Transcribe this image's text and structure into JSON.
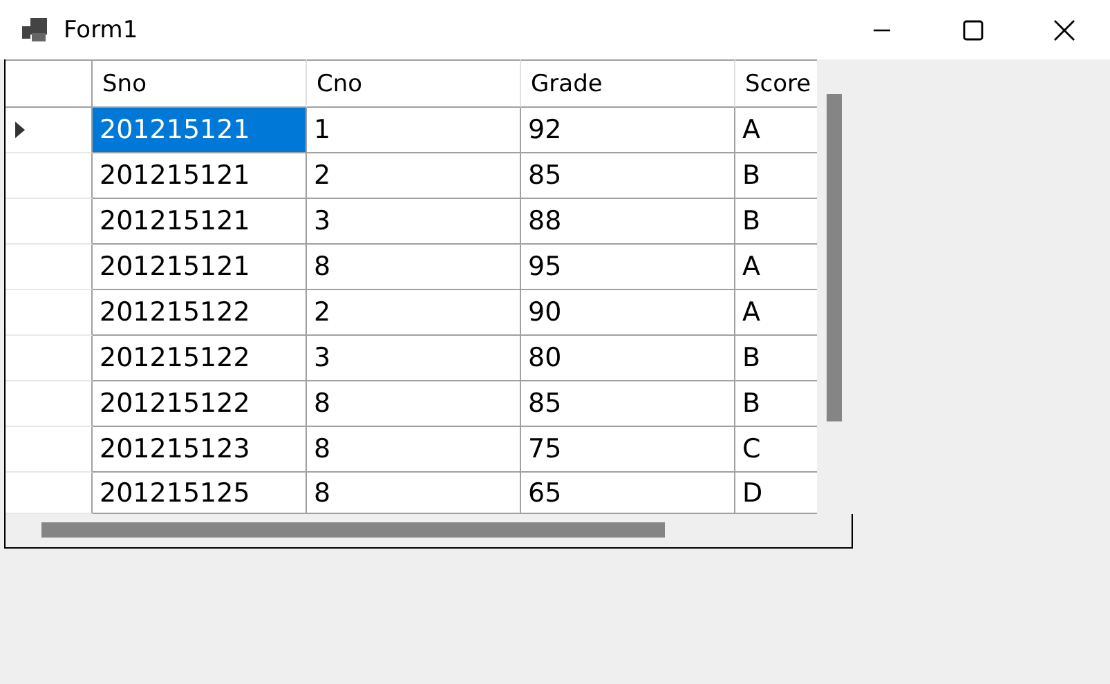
{
  "window": {
    "title": "Form1"
  },
  "table": {
    "columns": [
      "Sno",
      "Cno",
      "Grade",
      "Score"
    ],
    "rows": [
      {
        "current": true,
        "cells": [
          {
            "text": "201215121",
            "selected": true
          },
          {
            "text": "1",
            "selected": false
          },
          {
            "text": "92",
            "selected": false
          },
          {
            "text": "A",
            "selected": false
          }
        ]
      },
      {
        "current": false,
        "cells": [
          {
            "text": "201215121",
            "selected": false
          },
          {
            "text": "2",
            "selected": false
          },
          {
            "text": "85",
            "selected": false
          },
          {
            "text": "B",
            "selected": false
          }
        ]
      },
      {
        "current": false,
        "cells": [
          {
            "text": "201215121",
            "selected": false
          },
          {
            "text": "3",
            "selected": false
          },
          {
            "text": "88",
            "selected": false
          },
          {
            "text": "B",
            "selected": false
          }
        ]
      },
      {
        "current": false,
        "cells": [
          {
            "text": "201215121",
            "selected": false
          },
          {
            "text": "8",
            "selected": false
          },
          {
            "text": "95",
            "selected": false
          },
          {
            "text": "A",
            "selected": false
          }
        ]
      },
      {
        "current": false,
        "cells": [
          {
            "text": "201215122",
            "selected": false
          },
          {
            "text": "2",
            "selected": false
          },
          {
            "text": "90",
            "selected": false
          },
          {
            "text": "A",
            "selected": false
          }
        ]
      },
      {
        "current": false,
        "cells": [
          {
            "text": "201215122",
            "selected": false
          },
          {
            "text": "3",
            "selected": false
          },
          {
            "text": "80",
            "selected": false
          },
          {
            "text": "B",
            "selected": false
          }
        ]
      },
      {
        "current": false,
        "cells": [
          {
            "text": "201215122",
            "selected": false
          },
          {
            "text": "8",
            "selected": false
          },
          {
            "text": "85",
            "selected": false
          },
          {
            "text": "B",
            "selected": false
          }
        ]
      },
      {
        "current": false,
        "cells": [
          {
            "text": "201215123",
            "selected": false
          },
          {
            "text": "8",
            "selected": false
          },
          {
            "text": "75",
            "selected": false
          },
          {
            "text": "C",
            "selected": false
          }
        ]
      },
      {
        "current": false,
        "cells": [
          {
            "text": "201215125",
            "selected": false
          },
          {
            "text": "8",
            "selected": false
          },
          {
            "text": "65",
            "selected": false
          },
          {
            "text": "D",
            "selected": false
          }
        ]
      }
    ]
  }
}
